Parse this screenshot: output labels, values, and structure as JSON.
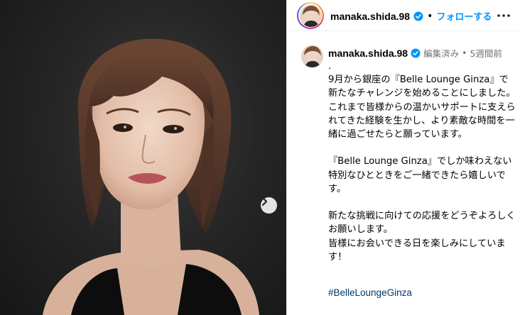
{
  "post": {
    "username": "manaka.shida.98",
    "follow_label": "フォローする",
    "separator": "•",
    "more_icon": "more-horizontal-icon",
    "next_icon": "chevron-right-icon",
    "verified_color": "#0095f6",
    "accent_color": "#0095f6"
  },
  "caption": {
    "username": "manaka.shida.98",
    "edited": "編集済み",
    "separator": "•",
    "time": "5週間前",
    "text": ".\n9月から銀座の『Belle Lounge Ginza』で新たなチャレンジを始めることにしました。\nこれまで皆様からの温かいサポートに支えられてきた経験を生かし、より素敵な時間を一緒に過ごせたらと願っています。\n\n『Belle Lounge Ginza』でしか味わえない特別なひとときをご一緒できたら嬉しいです。\n\n新たな挑戦に向けての応援をどうぞよろしくお願いします。\n皆様にお会いできる日を楽しみにしています！",
    "hashtag": "#BelleLoungeGinza"
  }
}
